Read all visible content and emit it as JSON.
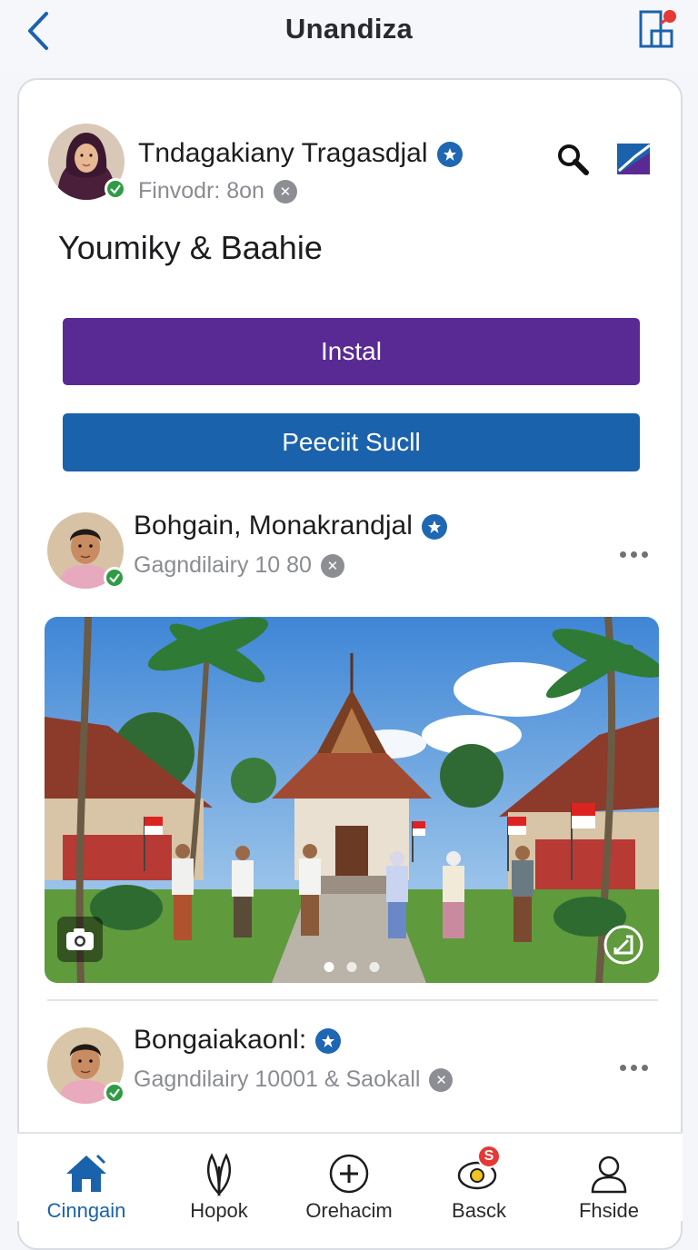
{
  "header": {
    "title": "Unandiza",
    "back_icon": "chevron-left-icon",
    "action_icon": "edit-document-icon"
  },
  "profile": {
    "name": "Tndagakiany Tragasdjal",
    "subtitle": "Finvodr: 8on",
    "headline": "Youmiky & Baahie",
    "install_label": "Instal",
    "secondary_label": "Peeciit Sucll",
    "colors": {
      "install": "#5a2a94",
      "secondary": "#1b62ac"
    }
  },
  "posts": [
    {
      "name": "Bohgain, Monakrandjal",
      "subtitle": "Gagndilairy 10 80"
    },
    {
      "name": "Bongaiakaonl:",
      "subtitle": "Gagndilairy 10001 & Saokall"
    }
  ],
  "gallery": {
    "page_count": 3,
    "active_page": 1
  },
  "nav": [
    {
      "label": "Cinngain",
      "icon": "home-icon",
      "active": true
    },
    {
      "label": "Hopok",
      "icon": "leaf-icon",
      "active": false
    },
    {
      "label": "Orehacim",
      "icon": "plus-circle-icon",
      "active": false
    },
    {
      "label": "Basck",
      "icon": "notification-icon",
      "active": false,
      "badge": "S"
    },
    {
      "label": "Fhside",
      "icon": "person-icon",
      "active": false
    }
  ]
}
